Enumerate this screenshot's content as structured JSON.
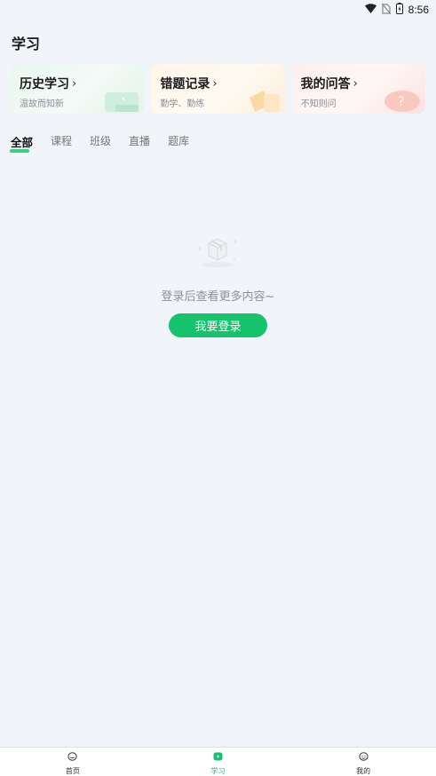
{
  "status_bar": {
    "time": "8:56"
  },
  "page": {
    "title": "学习"
  },
  "cards": [
    {
      "title": "历史学习",
      "subtitle": "温故而知新"
    },
    {
      "title": "错题记录",
      "subtitle": "勤学、勤练"
    },
    {
      "title": "我的问答",
      "subtitle": "不知则问"
    }
  ],
  "tabs": [
    {
      "label": "全部",
      "active": true
    },
    {
      "label": "课程"
    },
    {
      "label": "班级"
    },
    {
      "label": "直播"
    },
    {
      "label": "题库"
    }
  ],
  "empty_state": {
    "message": "登录后查看更多内容~",
    "button_label": "我要登录"
  },
  "bottom_nav": [
    {
      "label": "首页",
      "icon": "home-icon"
    },
    {
      "label": "学习",
      "icon": "study-icon",
      "active": true
    },
    {
      "label": "我的",
      "icon": "profile-icon"
    }
  ],
  "colors": {
    "accent": "#14c36b",
    "background": "#f1f4f8"
  }
}
